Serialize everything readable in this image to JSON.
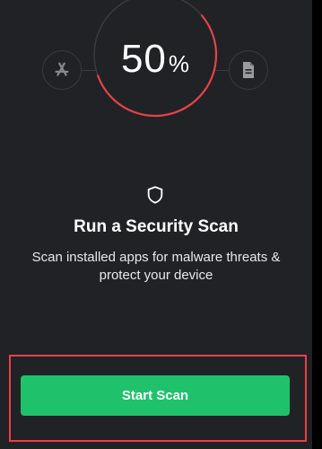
{
  "scan": {
    "progress_number": "50",
    "progress_symbol": "%",
    "progress_fraction": 0.5,
    "title": "Run a Security Scan",
    "description": "Scan installed apps for malware threats & protect your device",
    "start_button_label": "Start Scan"
  },
  "icons": {
    "left": "app-store-icon",
    "right": "document-icon",
    "center": "shield-icon"
  },
  "colors": {
    "background": "#212225",
    "ring_accent": "#e8414a",
    "button": "#1fc26b",
    "highlight_border": "#e8414a"
  }
}
